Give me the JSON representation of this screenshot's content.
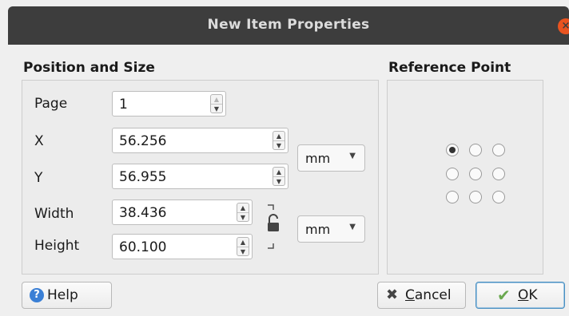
{
  "window": {
    "title": "New Item Properties",
    "close_glyph": "×"
  },
  "position_size": {
    "title": "Position and Size",
    "page": {
      "label": "Page",
      "value": "1"
    },
    "x": {
      "label": "X",
      "value": "56.256"
    },
    "y": {
      "label": "Y",
      "value": "56.955"
    },
    "width": {
      "label": "Width",
      "value": "38.436"
    },
    "height": {
      "label": "Height",
      "value": "60.100"
    },
    "position_unit": "mm",
    "size_unit": "mm"
  },
  "reference_point": {
    "title": "Reference Point",
    "selected": "upper-left"
  },
  "buttons": {
    "help": "Help",
    "cancel_prefix": "",
    "cancel_accel": "C",
    "cancel_rest": "ancel",
    "ok_accel": "O",
    "ok_rest": "K"
  },
  "icons": {
    "help": "help-icon",
    "cancel": "cancel-icon",
    "ok": "check-icon",
    "lock": "lock-icon"
  },
  "colors": {
    "titlebar": "#3d3d3d",
    "close": "#e95420",
    "default_button_border": "#4a90c2"
  }
}
